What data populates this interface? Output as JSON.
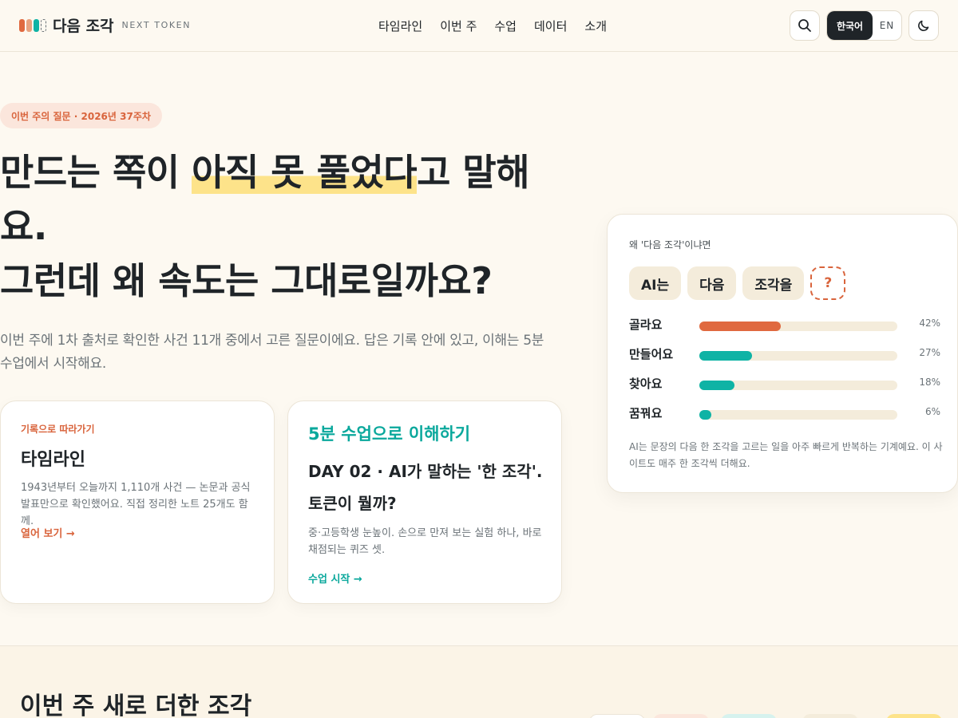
{
  "header": {
    "logo_title": "다음 조각",
    "logo_sub": "NEXT TOKEN",
    "nav": [
      "타임라인",
      "이번 주",
      "수업",
      "데이터",
      "소개"
    ],
    "lang_ko": "한국어",
    "lang_en": "EN"
  },
  "hero": {
    "pill": "이번 주의 질문 · 2026년 37주차",
    "headline_part1": "만드는 쪽이 ",
    "headline_highlight": "아직 못 풀었다",
    "headline_part2": "고 말해요.",
    "headline_line2": "그런데 왜 속도는 그대로일까요?",
    "lead": "이번 주에 1차 출처로 확인한 사건 11개 중에서 고른 질문이에요. 답은 기록 안에 있고, 이해는 5분 수업에서 시작해요."
  },
  "cards": {
    "timeline": {
      "eyebrow": "기록으로 따라가기",
      "title": "타임라인",
      "desc": "1943년부터 오늘까지 1,110개 사건 — 논문과 공식 발표만으로 확인했어요. 직접 정리한 노트 25개도 함께.",
      "link": "열어 보기 →"
    },
    "lesson": {
      "eyebrow": "5분 수업으로 이해하기",
      "title": "DAY 02 · AI가 말하는 '한 조각'. 토큰이 뭘까?",
      "desc": "중·고등학생 눈높이. 손으로 만져 보는 실험 하나, 바로 채점되는 퀴즈 셋.",
      "link": "수업 시작 →"
    }
  },
  "panel": {
    "title": "왜 '다음 조각'이냐면",
    "tokens": [
      "AI는",
      "다음",
      "조각을",
      "?"
    ],
    "bars": [
      {
        "label": "골라요",
        "pct": "42%",
        "value": 0.42,
        "color": "#e0693f"
      },
      {
        "label": "만들어요",
        "pct": "27%",
        "value": 0.27,
        "color": "#0fb3a5"
      },
      {
        "label": "찾아요",
        "pct": "18%",
        "value": 0.18,
        "color": "#0fb3a5"
      },
      {
        "label": "꿈꿔요",
        "pct": "6%",
        "value": 0.06,
        "color": "#0fb3a5"
      }
    ],
    "note": "AI는 문장의 다음 한 조각을 고르는 일을 아주 빠르게 반복하는 기계예요. 이 사이트도 매주 한 조각씩 더해요."
  },
  "section": {
    "title": "이번 주 새로 더한 조각"
  },
  "colors": {
    "accent_orange": "#d9643c",
    "accent_teal": "#0aa89c",
    "highlight": "#fde38a",
    "background": "#fdf9f1"
  }
}
